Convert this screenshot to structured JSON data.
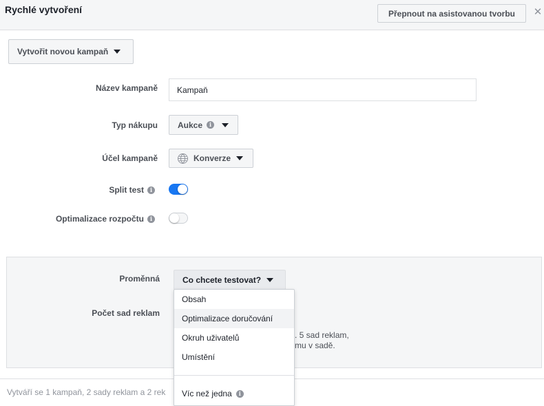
{
  "header": {
    "title": "Rychlé vytvoření",
    "assist_button": "Přepnout na asistovanou tvorbu",
    "close_icon": "close-icon"
  },
  "campaign_select": {
    "label": "Vytvořit novou kampaň"
  },
  "form": {
    "name_label": "Název kampaně",
    "name_value": "Kampaň",
    "buy_type_label": "Typ nákupu",
    "buy_type_value": "Aukce",
    "objective_label": "Účel kampaně",
    "objective_value": "Konverze",
    "split_test_label": "Split test",
    "split_test_on": true,
    "budget_opt_label": "Optimalizace rozpočtu",
    "budget_opt_on": false
  },
  "split_panel": {
    "variable_label": "Proměnná",
    "variable_button": "Co chcete testovat?",
    "ad_sets_label": "Počet sad reklam",
    "hint_line1": ". 5 sad reklam,",
    "hint_line2": "mu v sadě."
  },
  "dropdown": {
    "items": [
      "Obsah",
      "Optimalizace doručování",
      "Okruh uživatelů",
      "Umístění"
    ],
    "highlighted": "Optimalizace doručování",
    "extra_item": "Víc než jedna"
  },
  "footer": {
    "summary": "Vytváří se 1 kampaň, 2 sady reklam a 2 rek"
  },
  "colors": {
    "accent": "#1877f2",
    "panel_bg": "#f5f6f7",
    "border": "#dddfe2"
  }
}
